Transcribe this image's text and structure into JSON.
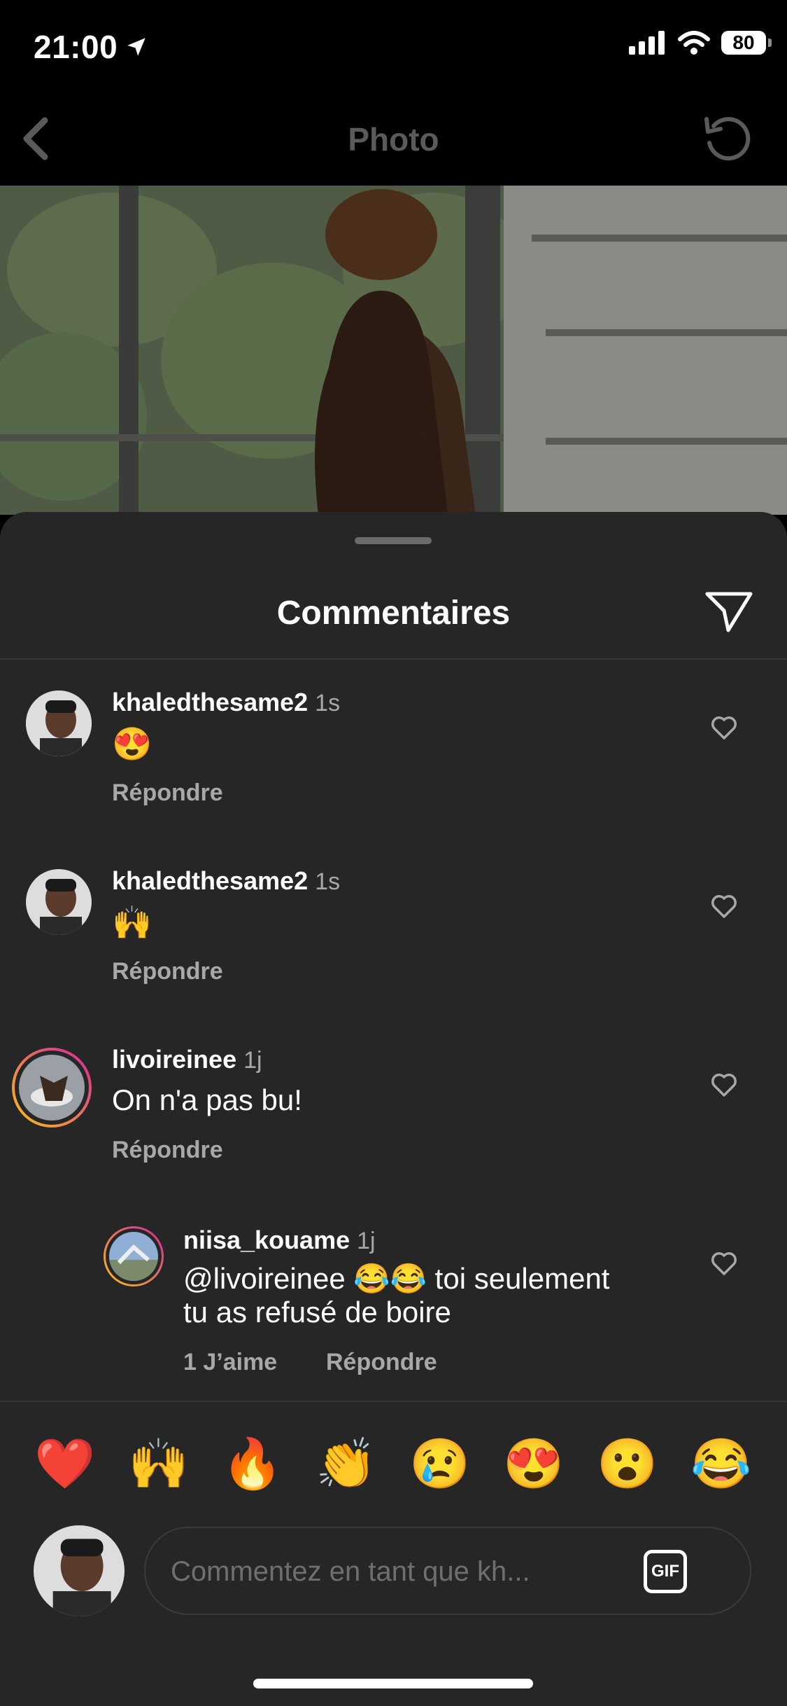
{
  "status_bar": {
    "time": "21:00",
    "battery": "80"
  },
  "nav": {
    "title": "Photo"
  },
  "sheet": {
    "title": "Commentaires"
  },
  "comments": [
    {
      "username": "khaledthesame2",
      "time": "1s",
      "text": "😍",
      "reply": "Répondre"
    },
    {
      "username": "khaledthesame2",
      "time": "1s",
      "text": "🙌",
      "reply": "Répondre"
    },
    {
      "username": "livoireinee",
      "time": "1j",
      "text": "On n'a pas bu!",
      "reply": "Répondre"
    },
    {
      "username": "niisa_kouame",
      "time": "1j",
      "text_line1": "@livoireinee 😂😂 toi seulement",
      "text_line2": "tu as refusé de boire",
      "likes": "1 J’aime",
      "reply": "Répondre"
    }
  ],
  "reactions": [
    "❤️",
    "🙌",
    "🔥",
    "👏",
    "😢",
    "😍",
    "😮",
    "😂"
  ],
  "composer": {
    "placeholder": "Commentez en tant que kh...",
    "gif_label": "GIF"
  },
  "colors": {
    "background": "#000000",
    "sheet": "#262626",
    "secondary_text": "#a8a8a8",
    "story_ring_start": "#f9c21b",
    "story_ring_end": "#d6249f"
  }
}
